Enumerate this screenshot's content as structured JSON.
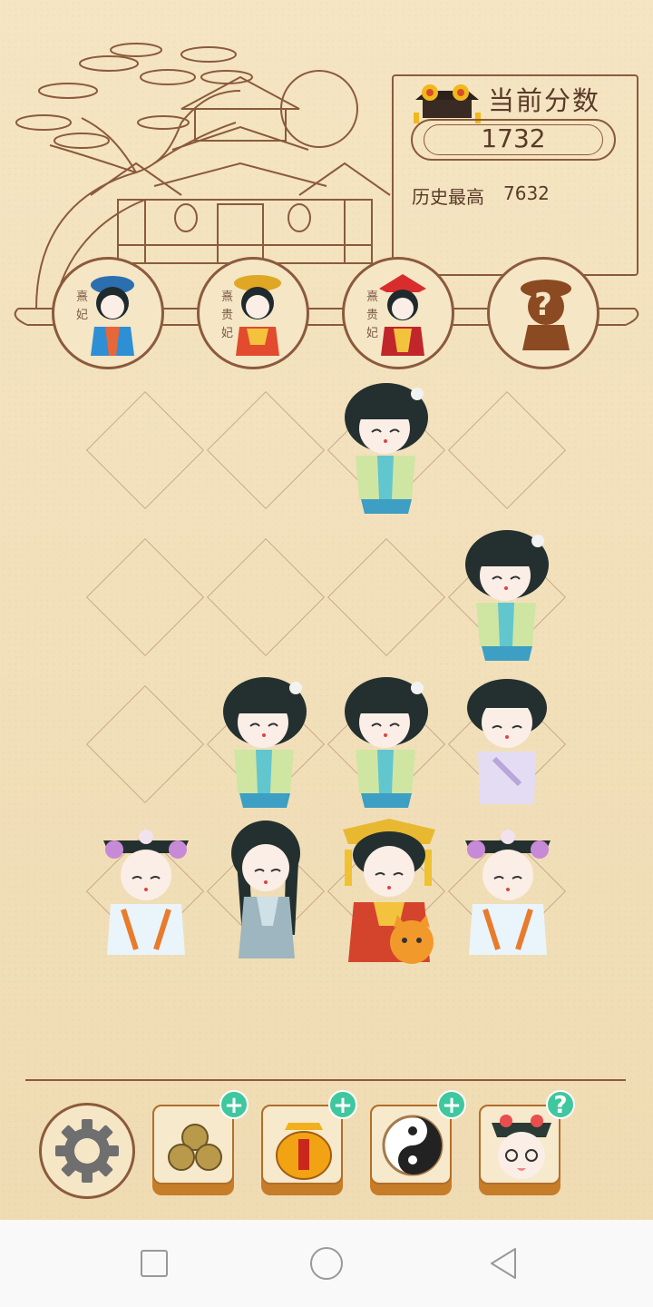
{
  "score_panel": {
    "title": "当前分数",
    "current_score": "1732",
    "best_label": "历史最高",
    "best_score": "7632"
  },
  "levels": [
    {
      "label": "熹妃",
      "icon": "consort-icon"
    },
    {
      "label": "熹贵妃",
      "icon": "noble-consort-icon"
    },
    {
      "label": "熹贵妃",
      "icon": "imperial-consort-icon"
    },
    {
      "label": "?",
      "icon": "locked-level-icon"
    }
  ],
  "toolbar": {
    "settings_icon": "gear-icon",
    "tools": [
      {
        "icon": "coins-icon",
        "badge": "+"
      },
      {
        "icon": "orange-jar-icon",
        "badge": "+"
      },
      {
        "icon": "yin-yang-icon",
        "badge": "+"
      },
      {
        "icon": "maid-face-icon",
        "badge": "?"
      }
    ]
  },
  "colors": {
    "background": "#f3e2bd",
    "line": "#8b5a3c",
    "badge": "#3fc79e",
    "tool_base": "#c77c28"
  }
}
